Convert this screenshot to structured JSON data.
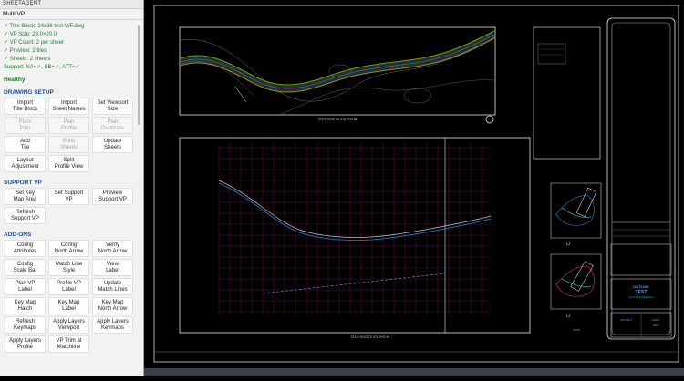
{
  "panel": {
    "title": "SHEETAGENT",
    "subtitle": "Multi VP"
  },
  "status": {
    "lines": [
      "✓ Title Block: 24x36 test-WF.dwg",
      "✓ VP Size: 23.0×20.0",
      "✓ VP Count: 2 per sheet",
      "✓ Preview: 2 tiles",
      "✓ Sheets: 2 sheets",
      "Support: NA=✓, SB=✓, ATT=✓"
    ],
    "health": "Healthy"
  },
  "sections": [
    {
      "title": "DRAWING SETUP",
      "buttons": [
        {
          "label": "Import\nTitle Block",
          "enabled": true
        },
        {
          "label": "Import\nSheet Names",
          "enabled": true
        },
        {
          "label": "Set Viewport\nSize",
          "enabled": true
        },
        {
          "label": "Plan/\nPlan",
          "enabled": false
        },
        {
          "label": "Plan\nProfile",
          "enabled": false
        },
        {
          "label": "Plan\nDuplicate",
          "enabled": false
        },
        {
          "label": "Add\nTile",
          "enabled": true
        },
        {
          "label": "Build\nSheets",
          "enabled": false
        },
        {
          "label": "Update\nSheets",
          "enabled": true
        },
        {
          "label": "Layout\nAdjustment",
          "enabled": true
        },
        {
          "label": "Split\nProfile View",
          "enabled": true
        }
      ]
    },
    {
      "title": "SUPPORT VP",
      "buttons": [
        {
          "label": "Set Key\nMap Area",
          "enabled": true
        },
        {
          "label": "Set Support\nVP",
          "enabled": true
        },
        {
          "label": "Preview\nSupport VP",
          "enabled": true
        },
        {
          "label": "Refresh\nSupport VP",
          "enabled": true
        }
      ]
    },
    {
      "title": "ADD-ONS",
      "buttons": [
        {
          "label": "Config\nAttributes",
          "enabled": true
        },
        {
          "label": "Config\nNorth Arrow",
          "enabled": true
        },
        {
          "label": "Verify\nNorth Arrow",
          "enabled": true
        },
        {
          "label": "Config\nScale Bar",
          "enabled": true
        },
        {
          "label": "Match Line\nStyle",
          "enabled": true
        },
        {
          "label": "View\nLabel",
          "enabled": true
        },
        {
          "label": "Plan VP\nLabel",
          "enabled": true
        },
        {
          "label": "Profile VP\nLabel",
          "enabled": true
        },
        {
          "label": "Update\nMatch Lines",
          "enabled": true
        },
        {
          "label": "Key Map\nHatch",
          "enabled": true
        },
        {
          "label": "Key Map\nLabel",
          "enabled": true
        },
        {
          "label": "Key Map\nNorth Arrow",
          "enabled": true
        },
        {
          "label": "Refresh\nKeymaps",
          "enabled": true
        },
        {
          "label": "Apply Layers\nViewport",
          "enabled": true
        },
        {
          "label": "Apply Layers\nKeymaps",
          "enabled": true
        },
        {
          "label": "Apply Layers\nProfile",
          "enabled": true
        },
        {
          "label": "VP Trim at\nMatchline",
          "enabled": true
        }
      ]
    }
  ],
  "drawing": {
    "plan_caption": "STA 0+00.00 TO STA 3+02.58",
    "profile_caption": "STA 0+00.00 TO STA 3+02.54",
    "title_block": {
      "logo_line1": "TEST",
      "logo_line2": "CIVIL ENGINEERING",
      "box_line1": "OUTLINE",
      "box_line2": "TEST",
      "sheet_line1": "PROJECT",
      "sheet_line2": "SHEET"
    }
  },
  "colors": {
    "panel_bg": "#f2f2f2",
    "status_green": "#1e7d2a",
    "section_blue": "#1d4f9a",
    "canvas_bg": "#000000",
    "alignment": "#2aa198",
    "grid": "#8a1b5a"
  }
}
